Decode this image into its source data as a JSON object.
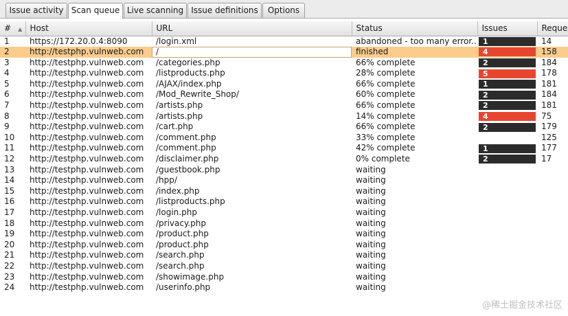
{
  "tabs": [
    {
      "label": "Issue activity",
      "active": false
    },
    {
      "label": "Scan queue",
      "active": true
    },
    {
      "label": "Live scanning",
      "active": false
    },
    {
      "label": "Issue definitions",
      "active": false
    },
    {
      "label": "Options",
      "active": false
    }
  ],
  "columns": [
    "#",
    "Host",
    "URL",
    "Status",
    "Issues",
    "Reques"
  ],
  "sort_indicator": "▲",
  "selected_row": 2,
  "issue_colors": {
    "dark": "#2b2b2b",
    "red": "#e8452f"
  },
  "rows": [
    {
      "num": "1",
      "host": "https://172.20.0.4:8090",
      "url": "/login.xml",
      "status": "abandoned - too many error...",
      "issues": "1",
      "issues_color": "dark",
      "requests": "14"
    },
    {
      "num": "2",
      "host": "http://testphp.vulnweb.com",
      "url": "/",
      "status": "finished",
      "issues": "4",
      "issues_color": "red",
      "requests": "158"
    },
    {
      "num": "3",
      "host": "http://testphp.vulnweb.com",
      "url": "/categories.php",
      "status": "66% complete",
      "issues": "2",
      "issues_color": "dark",
      "requests": "184"
    },
    {
      "num": "4",
      "host": "http://testphp.vulnweb.com",
      "url": "/listproducts.php",
      "status": "28% complete",
      "issues": "5",
      "issues_color": "red",
      "requests": "178"
    },
    {
      "num": "5",
      "host": "http://testphp.vulnweb.com",
      "url": "/AJAX/index.php",
      "status": "66% complete",
      "issues": "1",
      "issues_color": "dark",
      "requests": "181"
    },
    {
      "num": "6",
      "host": "http://testphp.vulnweb.com",
      "url": "/Mod_Rewrite_Shop/",
      "status": "60% complete",
      "issues": "2",
      "issues_color": "dark",
      "requests": "184"
    },
    {
      "num": "7",
      "host": "http://testphp.vulnweb.com",
      "url": "/artists.php",
      "status": "66% complete",
      "issues": "2",
      "issues_color": "dark",
      "requests": "181"
    },
    {
      "num": "8",
      "host": "http://testphp.vulnweb.com",
      "url": "/artists.php",
      "status": "14% complete",
      "issues": "4",
      "issues_color": "red",
      "requests": "75"
    },
    {
      "num": "9",
      "host": "http://testphp.vulnweb.com",
      "url": "/cart.php",
      "status": "66% complete",
      "issues": "2",
      "issues_color": "dark",
      "requests": "179"
    },
    {
      "num": "10",
      "host": "http://testphp.vulnweb.com",
      "url": "/comment.php",
      "status": "33% complete",
      "issues": "",
      "issues_color": "",
      "requests": "125"
    },
    {
      "num": "11",
      "host": "http://testphp.vulnweb.com",
      "url": "/comment.php",
      "status": "42% complete",
      "issues": "1",
      "issues_color": "dark",
      "requests": "177"
    },
    {
      "num": "12",
      "host": "http://testphp.vulnweb.com",
      "url": "/disclaimer.php",
      "status": "0% complete",
      "issues": "2",
      "issues_color": "dark",
      "requests": "17"
    },
    {
      "num": "13",
      "host": "http://testphp.vulnweb.com",
      "url": "/guestbook.php",
      "status": "waiting",
      "issues": "",
      "issues_color": "",
      "requests": ""
    },
    {
      "num": "14",
      "host": "http://testphp.vulnweb.com",
      "url": "/hpp/",
      "status": "waiting",
      "issues": "",
      "issues_color": "",
      "requests": ""
    },
    {
      "num": "15",
      "host": "http://testphp.vulnweb.com",
      "url": "/index.php",
      "status": "waiting",
      "issues": "",
      "issues_color": "",
      "requests": ""
    },
    {
      "num": "16",
      "host": "http://testphp.vulnweb.com",
      "url": "/listproducts.php",
      "status": "waiting",
      "issues": "",
      "issues_color": "",
      "requests": ""
    },
    {
      "num": "17",
      "host": "http://testphp.vulnweb.com",
      "url": "/login.php",
      "status": "waiting",
      "issues": "",
      "issues_color": "",
      "requests": ""
    },
    {
      "num": "18",
      "host": "http://testphp.vulnweb.com",
      "url": "/privacy.php",
      "status": "waiting",
      "issues": "",
      "issues_color": "",
      "requests": ""
    },
    {
      "num": "19",
      "host": "http://testphp.vulnweb.com",
      "url": "/product.php",
      "status": "waiting",
      "issues": "",
      "issues_color": "",
      "requests": ""
    },
    {
      "num": "20",
      "host": "http://testphp.vulnweb.com",
      "url": "/product.php",
      "status": "waiting",
      "issues": "",
      "issues_color": "",
      "requests": ""
    },
    {
      "num": "21",
      "host": "http://testphp.vulnweb.com",
      "url": "/search.php",
      "status": "waiting",
      "issues": "",
      "issues_color": "",
      "requests": ""
    },
    {
      "num": "22",
      "host": "http://testphp.vulnweb.com",
      "url": "/search.php",
      "status": "waiting",
      "issues": "",
      "issues_color": "",
      "requests": ""
    },
    {
      "num": "23",
      "host": "http://testphp.vulnweb.com",
      "url": "/showimage.php",
      "status": "waiting",
      "issues": "",
      "issues_color": "",
      "requests": ""
    },
    {
      "num": "24",
      "host": "http://testphp.vulnweb.com",
      "url": "/userinfo.php",
      "status": "waiting",
      "issues": "",
      "issues_color": "",
      "requests": ""
    }
  ],
  "watermark": "@稀土掘金技术社区"
}
